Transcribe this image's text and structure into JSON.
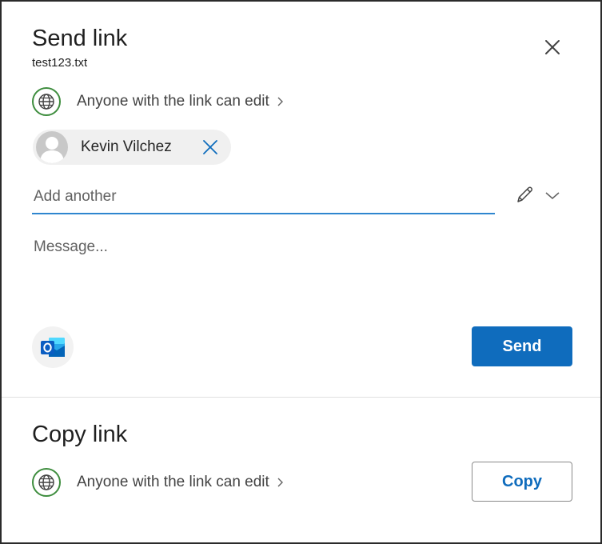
{
  "send_link": {
    "title": "Send link",
    "filename": "test123.txt",
    "permission": {
      "icon": "globe-icon",
      "label": "Anyone with the link can edit"
    },
    "recipients": [
      {
        "name": "Kevin Vilchez",
        "avatar": "default-person-avatar"
      }
    ],
    "add_input": {
      "value": "",
      "placeholder": "Add another"
    },
    "permission_toggle_icon": "pencil-icon",
    "message_input": {
      "value": "",
      "placeholder": "Message..."
    },
    "outlook_icon": "outlook-icon",
    "send_label": "Send"
  },
  "copy_link": {
    "title": "Copy link",
    "permission": {
      "icon": "globe-icon",
      "label": "Anyone with the link can edit"
    },
    "copy_label": "Copy"
  },
  "colors": {
    "accent": "#0f6cbd",
    "input_underline": "#2f86cf",
    "globe": "#3e8d3e",
    "chip_bg": "#f0f0f0",
    "outlook_blue": "#0a5dc2"
  }
}
